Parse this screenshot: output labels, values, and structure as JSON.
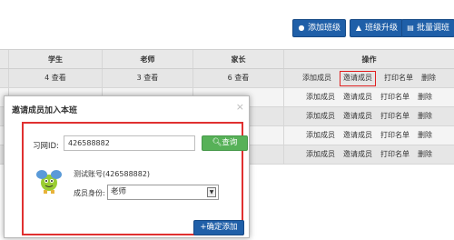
{
  "toolbar": {
    "add_class": {
      "label": "添加班级",
      "icon": "user-icon"
    },
    "class_upgrade": {
      "label": "班级升级",
      "icon": "upgrade-icon"
    },
    "batch_adjust": {
      "label": "批量调班",
      "icon": "document-icon"
    }
  },
  "table": {
    "headers": [
      "学生",
      "老师",
      "家长",
      "操作"
    ],
    "rows": [
      {
        "students": "4 查看",
        "teachers": "3 查看",
        "parents": "6 查看"
      },
      {
        "students": "",
        "teachers": "",
        "parents": ""
      },
      {
        "students": "",
        "teachers": "",
        "parents": ""
      },
      {
        "students": "",
        "teachers": "",
        "parents": ""
      },
      {
        "students": "",
        "teachers": "",
        "parents": ""
      },
      {
        "students": "",
        "teachers": "",
        "parents": ""
      }
    ],
    "ops": {
      "add_member": "添加成员",
      "invite_member": "邀请成员",
      "print_list": "打印名单",
      "delete": "删除"
    }
  },
  "dialog": {
    "title": "邀请成员加入本班",
    "close_icon": "×",
    "id_label": "习网ID:",
    "id_value": "426588882",
    "search_label": "查询",
    "account_text": "测试账号(426588882)",
    "role_label": "成员身份:",
    "role_value": "老师",
    "confirm_label": "确定添加"
  },
  "colors": {
    "accent_blue": "#1f5fa8",
    "search_green": "#57b158",
    "highlight_red": "#e02020"
  }
}
